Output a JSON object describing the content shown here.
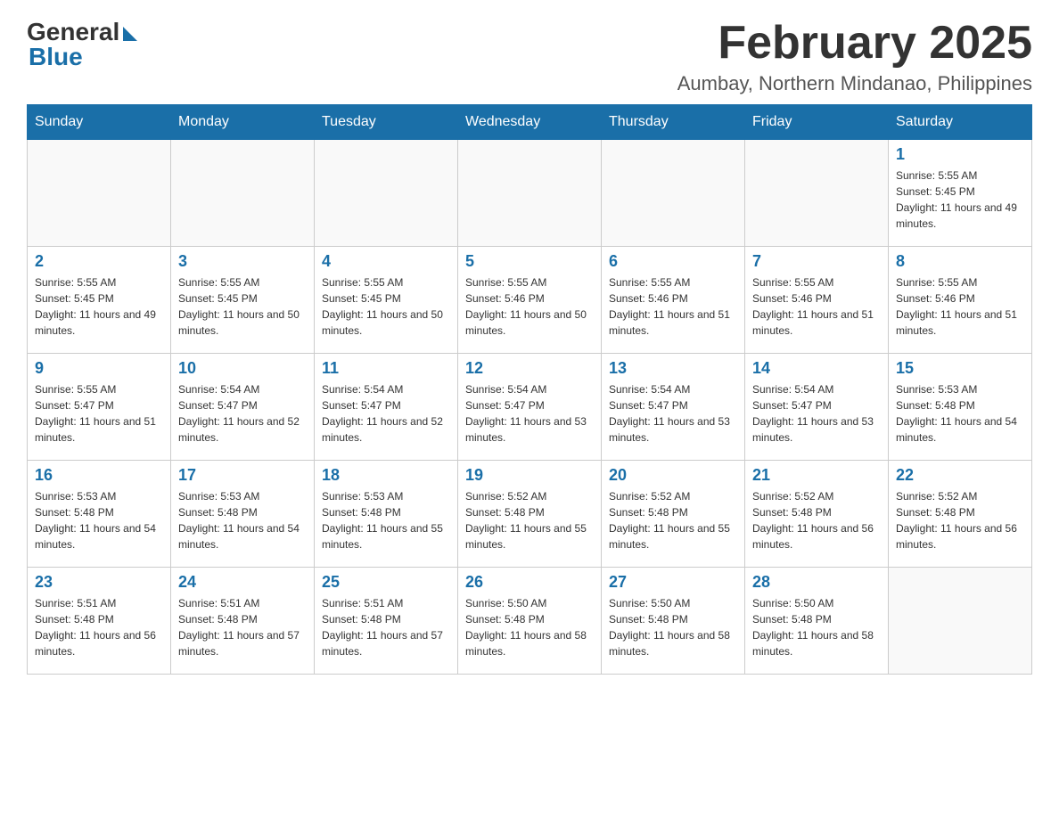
{
  "header": {
    "logo_general": "General",
    "logo_blue": "Blue",
    "month_title": "February 2025",
    "location": "Aumbay, Northern Mindanao, Philippines"
  },
  "days_of_week": [
    "Sunday",
    "Monday",
    "Tuesday",
    "Wednesday",
    "Thursday",
    "Friday",
    "Saturday"
  ],
  "weeks": [
    [
      {
        "day": "",
        "info": ""
      },
      {
        "day": "",
        "info": ""
      },
      {
        "day": "",
        "info": ""
      },
      {
        "day": "",
        "info": ""
      },
      {
        "day": "",
        "info": ""
      },
      {
        "day": "",
        "info": ""
      },
      {
        "day": "1",
        "info": "Sunrise: 5:55 AM\nSunset: 5:45 PM\nDaylight: 11 hours and 49 minutes."
      }
    ],
    [
      {
        "day": "2",
        "info": "Sunrise: 5:55 AM\nSunset: 5:45 PM\nDaylight: 11 hours and 49 minutes."
      },
      {
        "day": "3",
        "info": "Sunrise: 5:55 AM\nSunset: 5:45 PM\nDaylight: 11 hours and 50 minutes."
      },
      {
        "day": "4",
        "info": "Sunrise: 5:55 AM\nSunset: 5:45 PM\nDaylight: 11 hours and 50 minutes."
      },
      {
        "day": "5",
        "info": "Sunrise: 5:55 AM\nSunset: 5:46 PM\nDaylight: 11 hours and 50 minutes."
      },
      {
        "day": "6",
        "info": "Sunrise: 5:55 AM\nSunset: 5:46 PM\nDaylight: 11 hours and 51 minutes."
      },
      {
        "day": "7",
        "info": "Sunrise: 5:55 AM\nSunset: 5:46 PM\nDaylight: 11 hours and 51 minutes."
      },
      {
        "day": "8",
        "info": "Sunrise: 5:55 AM\nSunset: 5:46 PM\nDaylight: 11 hours and 51 minutes."
      }
    ],
    [
      {
        "day": "9",
        "info": "Sunrise: 5:55 AM\nSunset: 5:47 PM\nDaylight: 11 hours and 51 minutes."
      },
      {
        "day": "10",
        "info": "Sunrise: 5:54 AM\nSunset: 5:47 PM\nDaylight: 11 hours and 52 minutes."
      },
      {
        "day": "11",
        "info": "Sunrise: 5:54 AM\nSunset: 5:47 PM\nDaylight: 11 hours and 52 minutes."
      },
      {
        "day": "12",
        "info": "Sunrise: 5:54 AM\nSunset: 5:47 PM\nDaylight: 11 hours and 53 minutes."
      },
      {
        "day": "13",
        "info": "Sunrise: 5:54 AM\nSunset: 5:47 PM\nDaylight: 11 hours and 53 minutes."
      },
      {
        "day": "14",
        "info": "Sunrise: 5:54 AM\nSunset: 5:47 PM\nDaylight: 11 hours and 53 minutes."
      },
      {
        "day": "15",
        "info": "Sunrise: 5:53 AM\nSunset: 5:48 PM\nDaylight: 11 hours and 54 minutes."
      }
    ],
    [
      {
        "day": "16",
        "info": "Sunrise: 5:53 AM\nSunset: 5:48 PM\nDaylight: 11 hours and 54 minutes."
      },
      {
        "day": "17",
        "info": "Sunrise: 5:53 AM\nSunset: 5:48 PM\nDaylight: 11 hours and 54 minutes."
      },
      {
        "day": "18",
        "info": "Sunrise: 5:53 AM\nSunset: 5:48 PM\nDaylight: 11 hours and 55 minutes."
      },
      {
        "day": "19",
        "info": "Sunrise: 5:52 AM\nSunset: 5:48 PM\nDaylight: 11 hours and 55 minutes."
      },
      {
        "day": "20",
        "info": "Sunrise: 5:52 AM\nSunset: 5:48 PM\nDaylight: 11 hours and 55 minutes."
      },
      {
        "day": "21",
        "info": "Sunrise: 5:52 AM\nSunset: 5:48 PM\nDaylight: 11 hours and 56 minutes."
      },
      {
        "day": "22",
        "info": "Sunrise: 5:52 AM\nSunset: 5:48 PM\nDaylight: 11 hours and 56 minutes."
      }
    ],
    [
      {
        "day": "23",
        "info": "Sunrise: 5:51 AM\nSunset: 5:48 PM\nDaylight: 11 hours and 56 minutes."
      },
      {
        "day": "24",
        "info": "Sunrise: 5:51 AM\nSunset: 5:48 PM\nDaylight: 11 hours and 57 minutes."
      },
      {
        "day": "25",
        "info": "Sunrise: 5:51 AM\nSunset: 5:48 PM\nDaylight: 11 hours and 57 minutes."
      },
      {
        "day": "26",
        "info": "Sunrise: 5:50 AM\nSunset: 5:48 PM\nDaylight: 11 hours and 58 minutes."
      },
      {
        "day": "27",
        "info": "Sunrise: 5:50 AM\nSunset: 5:48 PM\nDaylight: 11 hours and 58 minutes."
      },
      {
        "day": "28",
        "info": "Sunrise: 5:50 AM\nSunset: 5:48 PM\nDaylight: 11 hours and 58 minutes."
      },
      {
        "day": "",
        "info": ""
      }
    ]
  ]
}
